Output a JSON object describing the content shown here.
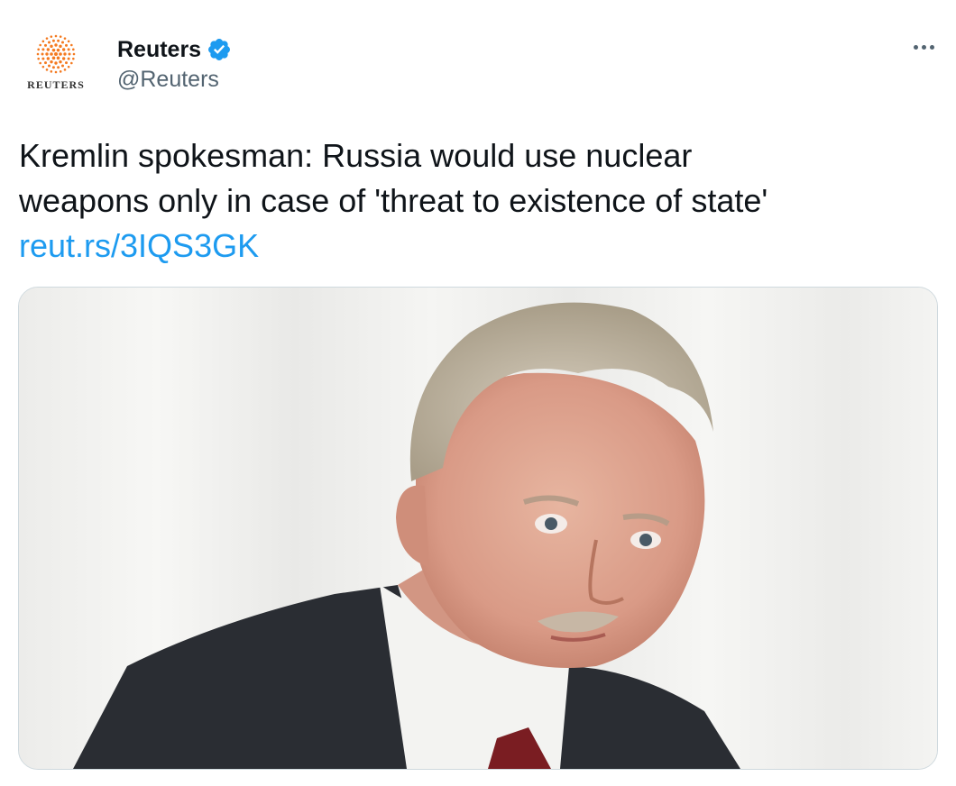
{
  "tweet": {
    "avatar": {
      "icon": "reuters-logo-icon",
      "wordmark": "REUTERS",
      "color": "#f47a20"
    },
    "author": {
      "display_name": "Reuters",
      "handle": "@Reuters",
      "verified": true,
      "verified_color": "#1d9bf0"
    },
    "more_icon": "ellipsis-icon",
    "text_lines": [
      "Kremlin spokesman: Russia would use nuclear",
      "weapons only in case of 'threat to existence of state'"
    ],
    "link_text": "reut.rs/3IQS3GK",
    "link_color": "#1d9bf0",
    "media": {
      "kind": "photo",
      "icon": "photo-man-portrait-icon"
    }
  }
}
